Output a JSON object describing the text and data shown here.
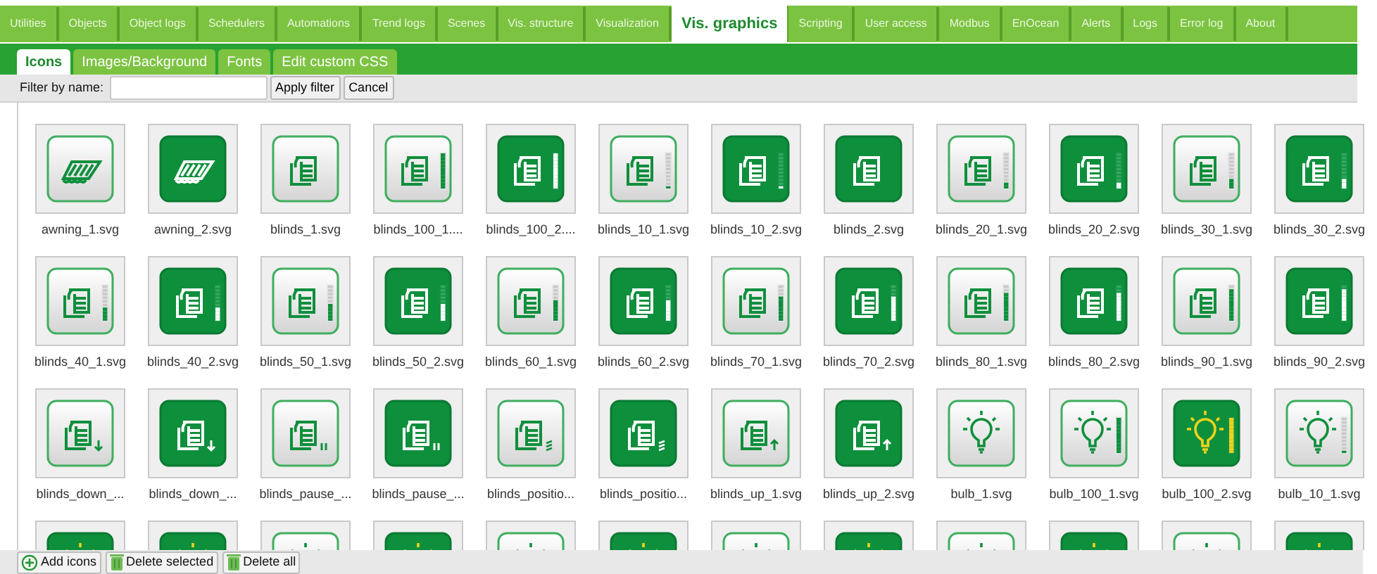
{
  "main_tabs": [
    {
      "label": "Utilities",
      "selected": false
    },
    {
      "label": "Objects",
      "selected": false
    },
    {
      "label": "Object logs",
      "selected": false
    },
    {
      "label": "Schedulers",
      "selected": false
    },
    {
      "label": "Automations",
      "selected": false
    },
    {
      "label": "Trend logs",
      "selected": false
    },
    {
      "label": "Scenes",
      "selected": false
    },
    {
      "label": "Vis. structure",
      "selected": false
    },
    {
      "label": "Visualization",
      "selected": false
    },
    {
      "label": "Vis. graphics",
      "selected": true
    },
    {
      "label": "Scripting",
      "selected": false
    },
    {
      "label": "User access",
      "selected": false
    },
    {
      "label": "Modbus",
      "selected": false
    },
    {
      "label": "EnOcean",
      "selected": false
    },
    {
      "label": "Alerts",
      "selected": false
    },
    {
      "label": "Logs",
      "selected": false
    },
    {
      "label": "Error log",
      "selected": false
    },
    {
      "label": "About",
      "selected": false
    }
  ],
  "sub_tabs": [
    {
      "label": "Icons",
      "selected": true
    },
    {
      "label": "Images/Background",
      "selected": false
    },
    {
      "label": "Fonts",
      "selected": false
    },
    {
      "label": "Edit custom CSS",
      "selected": false
    }
  ],
  "filter": {
    "label": "Filter by name:",
    "buttons": [
      "Apply filter",
      "Cancel"
    ]
  },
  "icons": [
    {
      "kind": "awning",
      "filled": false,
      "name": "awning_1.svg"
    },
    {
      "kind": "awning",
      "filled": true,
      "name": "awning_2.svg"
    },
    {
      "kind": "blinds",
      "filled": false,
      "name": "blinds_1.svg"
    },
    {
      "kind": "blinds",
      "filled": false,
      "level": 1,
      "name": "blinds_100_1...."
    },
    {
      "kind": "blinds",
      "filled": true,
      "level": 1,
      "name": "blinds_100_2...."
    },
    {
      "kind": "blinds",
      "filled": false,
      "level": 0.1,
      "name": "blinds_10_1.svg"
    },
    {
      "kind": "blinds",
      "filled": true,
      "level": 0.1,
      "name": "blinds_10_2.svg"
    },
    {
      "kind": "blinds",
      "filled": true,
      "name": "blinds_2.svg"
    },
    {
      "kind": "blinds",
      "filled": false,
      "level": 0.2,
      "name": "blinds_20_1.svg"
    },
    {
      "kind": "blinds",
      "filled": true,
      "level": 0.2,
      "name": "blinds_20_2.svg"
    },
    {
      "kind": "blinds",
      "filled": false,
      "level": 0.3,
      "name": "blinds_30_1.svg"
    },
    {
      "kind": "blinds",
      "filled": true,
      "level": 0.3,
      "name": "blinds_30_2.svg"
    },
    {
      "kind": "blinds",
      "filled": false,
      "level": 0.4,
      "name": "blinds_40_1.svg"
    },
    {
      "kind": "blinds",
      "filled": true,
      "level": 0.4,
      "name": "blinds_40_2.svg"
    },
    {
      "kind": "blinds",
      "filled": false,
      "level": 0.5,
      "name": "blinds_50_1.svg"
    },
    {
      "kind": "blinds",
      "filled": true,
      "level": 0.5,
      "name": "blinds_50_2.svg"
    },
    {
      "kind": "blinds",
      "filled": false,
      "level": 0.6,
      "name": "blinds_60_1.svg"
    },
    {
      "kind": "blinds",
      "filled": true,
      "level": 0.6,
      "name": "blinds_60_2.svg"
    },
    {
      "kind": "blinds",
      "filled": false,
      "level": 0.7,
      "name": "blinds_70_1.svg"
    },
    {
      "kind": "blinds",
      "filled": true,
      "level": 0.7,
      "name": "blinds_70_2.svg"
    },
    {
      "kind": "blinds",
      "filled": false,
      "level": 0.8,
      "name": "blinds_80_1.svg"
    },
    {
      "kind": "blinds",
      "filled": true,
      "level": 0.8,
      "name": "blinds_80_2.svg"
    },
    {
      "kind": "blinds",
      "filled": false,
      "level": 0.9,
      "name": "blinds_90_1.svg"
    },
    {
      "kind": "blinds",
      "filled": true,
      "level": 0.9,
      "name": "blinds_90_2.svg"
    },
    {
      "kind": "blinds-down",
      "filled": false,
      "name": "blinds_down_..."
    },
    {
      "kind": "blinds-down",
      "filled": true,
      "name": "blinds_down_..."
    },
    {
      "kind": "blinds-pause",
      "filled": false,
      "name": "blinds_pause_..."
    },
    {
      "kind": "blinds-pause",
      "filled": true,
      "name": "blinds_pause_..."
    },
    {
      "kind": "blinds-position",
      "filled": false,
      "name": "blinds_positio..."
    },
    {
      "kind": "blinds-position",
      "filled": true,
      "name": "blinds_positio..."
    },
    {
      "kind": "blinds-up",
      "filled": false,
      "name": "blinds_up_1.svg"
    },
    {
      "kind": "blinds-up",
      "filled": true,
      "name": "blinds_up_2.svg"
    },
    {
      "kind": "bulb",
      "filled": false,
      "name": "bulb_1.svg"
    },
    {
      "kind": "bulb",
      "filled": false,
      "level": 1,
      "name": "bulb_100_1.svg"
    },
    {
      "kind": "bulb",
      "filled": true,
      "level": 1,
      "name": "bulb_100_2.svg"
    },
    {
      "kind": "bulb",
      "filled": false,
      "level": 0.1,
      "name": "bulb_10_1.svg"
    },
    {
      "kind": "bulb",
      "filled": true
    },
    {
      "kind": "bulb",
      "filled": true
    },
    {
      "kind": "bulb",
      "filled": false
    },
    {
      "kind": "bulb",
      "filled": true
    },
    {
      "kind": "bulb",
      "filled": false
    },
    {
      "kind": "bulb",
      "filled": true
    },
    {
      "kind": "bulb",
      "filled": false
    },
    {
      "kind": "bulb",
      "filled": true
    },
    {
      "kind": "bulb",
      "filled": false
    },
    {
      "kind": "bulb",
      "filled": true
    },
    {
      "kind": "bulb",
      "filled": false
    },
    {
      "kind": "bulb",
      "filled": true
    }
  ],
  "bottom_buttons": [
    {
      "kind": "add",
      "label": "Add icons"
    },
    {
      "kind": "delete",
      "label": "Delete selected"
    },
    {
      "kind": "delete",
      "label": "Delete all"
    }
  ]
}
